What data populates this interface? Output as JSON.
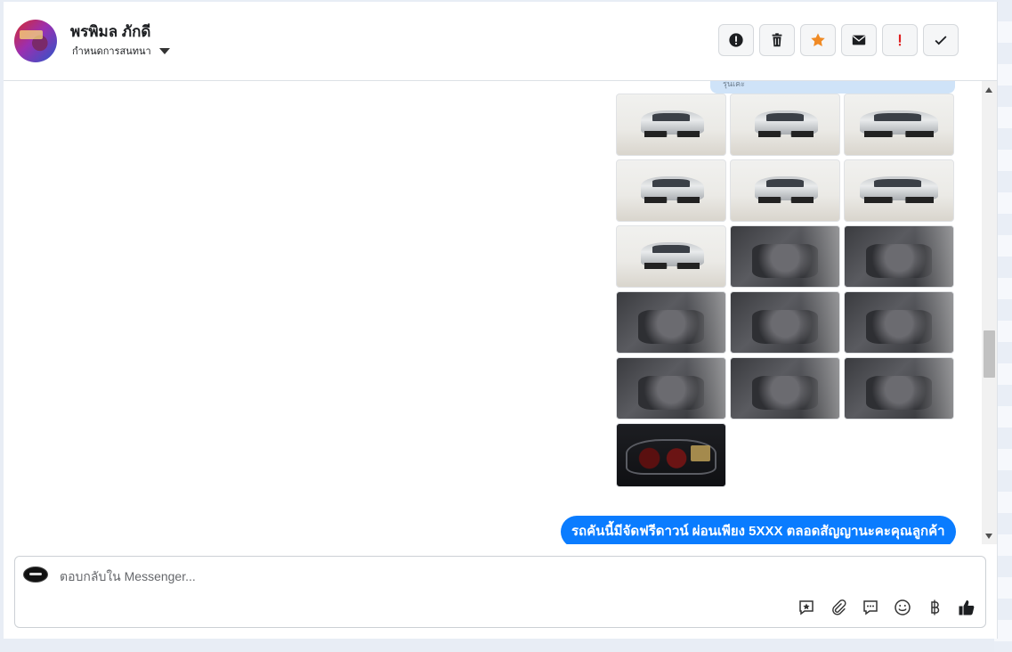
{
  "contact": {
    "name": "พรพิมล ภักดี",
    "assign_label": "กำหนดการสนทนา"
  },
  "actions": [
    {
      "name": "alert-circle-button",
      "icon": "alert-circle-icon"
    },
    {
      "name": "delete-button",
      "icon": "trash-icon"
    },
    {
      "name": "star-button",
      "icon": "star-icon",
      "color": "#f08a24"
    },
    {
      "name": "mark-unread-button",
      "icon": "envelope-icon"
    },
    {
      "name": "important-button",
      "icon": "exclamation-icon",
      "color": "#e02020"
    },
    {
      "name": "done-button",
      "icon": "check-icon"
    }
  ],
  "thread": {
    "top_bubble_text": "รุ่นเคะ",
    "photos": [
      {
        "kind": "exterior"
      },
      {
        "kind": "exterior"
      },
      {
        "kind": "exterior"
      },
      {
        "kind": "exterior"
      },
      {
        "kind": "exterior"
      },
      {
        "kind": "exterior"
      },
      {
        "kind": "exterior"
      },
      {
        "kind": "interior"
      },
      {
        "kind": "interior"
      },
      {
        "kind": "interior"
      },
      {
        "kind": "interior"
      },
      {
        "kind": "interior"
      },
      {
        "kind": "interior"
      },
      {
        "kind": "interior"
      },
      {
        "kind": "interior"
      },
      {
        "kind": "dashboard"
      }
    ],
    "outgoing_message": "รถคันนี้มีจัดฟรีดาวน์ ผ่อนเพียง 5XXX ตลอดสัญญานะคะคุณลูกค้า"
  },
  "composer": {
    "placeholder": "ตอบกลับใน Messenger...",
    "tools": [
      "saved-reply-icon",
      "attachment-icon",
      "chat-bubble-icon",
      "emoji-icon",
      "baht-icon",
      "thumbs-up-icon"
    ]
  },
  "colors": {
    "brand_blue": "#0a7cff",
    "star_orange": "#f08a24",
    "alert_red": "#e02020"
  }
}
